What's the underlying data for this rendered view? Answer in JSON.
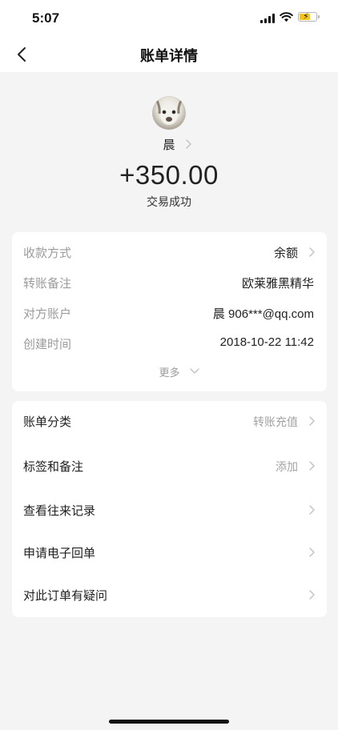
{
  "status_bar": {
    "time": "5:07"
  },
  "nav": {
    "title": "账单详情"
  },
  "payer": {
    "name": "晨"
  },
  "transaction": {
    "amount": "+350.00",
    "status": "交易成功"
  },
  "details": [
    {
      "label": "收款方式",
      "value": "余额"
    },
    {
      "label": "转账备注",
      "value": "欧莱雅黑精华"
    },
    {
      "label": "对方账户",
      "value": "晨 906***@qq.com"
    },
    {
      "label": "创建时间",
      "value": "2018-10-22 11:42"
    }
  ],
  "more_label": "更多",
  "menu": [
    {
      "label": "账单分类",
      "value": "转账充值"
    },
    {
      "label": "标签和备注",
      "value": "添加"
    },
    {
      "label": "查看往来记录",
      "value": ""
    },
    {
      "label": "申请电子回单",
      "value": ""
    },
    {
      "label": "对此订单有疑问",
      "value": ""
    }
  ],
  "colors": {
    "background": "#f4f4f4",
    "card": "#ffffff",
    "muted_text": "#9b9b9b",
    "chevron": "#c4c4c4",
    "battery_charging": "#f5c518"
  }
}
